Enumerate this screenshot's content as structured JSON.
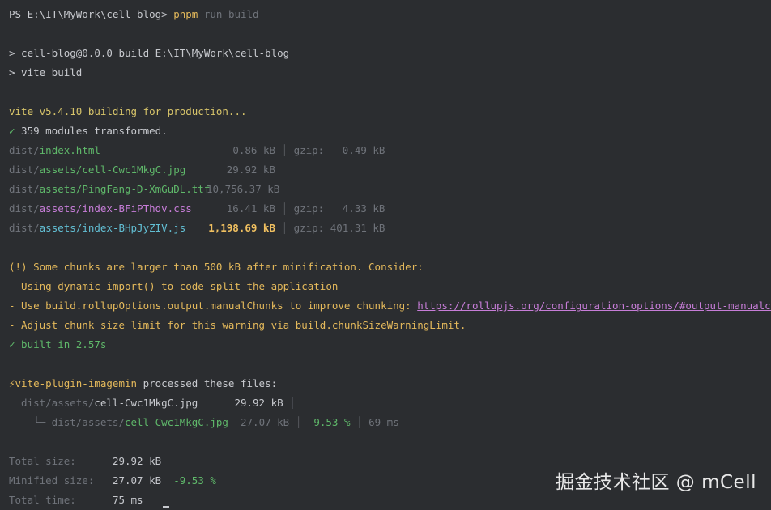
{
  "prompt": {
    "prefix": "PS E:\\IT\\MyWork\\cell-blog> ",
    "command": "pnpm",
    "args": " run build"
  },
  "script": {
    "line1": "> cell-blog@0.0.0 build E:\\IT\\MyWork\\cell-blog",
    "line2": "> vite build"
  },
  "vite": {
    "building": "vite v5.4.10 building for production...",
    "transformed": "✓ 359 modules transformed.",
    "outputs": [
      {
        "dir": "dist/",
        "name": "index.html",
        "color": "green",
        "size": "0.86 kB",
        "gzip": "gzip:   0.49 kB"
      },
      {
        "dir": "dist/",
        "name": "assets/cell-Cwc1MkgC.jpg",
        "color": "green",
        "size": "29.92 kB",
        "gzip": ""
      },
      {
        "dir": "dist/",
        "name": "assets/PingFang-D-XmGuDL.ttf",
        "color": "green",
        "size": "10,756.37 kB",
        "gzip": ""
      },
      {
        "dir": "dist/",
        "name": "assets/index-BFiPThdv.css",
        "color": "magenta",
        "size": "16.41 kB",
        "gzip": "gzip:   4.33 kB"
      },
      {
        "dir": "dist/",
        "name": "assets/index-BHpJyZIV.js",
        "color": "cyan",
        "size": "1,198.69 kB",
        "gzip": "gzip: 401.31 kB"
      }
    ]
  },
  "warning": {
    "line1": "(!) Some chunks are larger than 500 kB after minification. Consider:",
    "line2": "- Using dynamic import() to code-split the application",
    "line3_prefix": "- Use build.rollupOptions.output.manualChunks to improve chunking: ",
    "line3_link": "https://rollupjs.org/configuration-options/#output-manualchunks",
    "line4": "- Adjust chunk size limit for this warning via build.chunkSizeWarningLimit.",
    "built": "✓ built in 2.57s"
  },
  "imagemin": {
    "header_plugin": "⚡vite-plugin-imagemin",
    "header_rest": " processed these files:",
    "row1_dir": "  dist/assets/",
    "row1_file": "cell-Cwc1MkgC.jpg",
    "row1_size": "29.92 kB",
    "row2_prefix": "    └─ dist/assets/",
    "row2_file": "cell-Cwc1MkgC.jpg",
    "row2_size": "27.07 kB",
    "row2_ratio": "-9.53 %",
    "row2_time": "69 ms"
  },
  "summary": {
    "total_label": "Total size:",
    "total_value": "29.92 kB",
    "min_label": "Minified size:",
    "min_value": "27.07 kB",
    "min_ratio": "-9.53 %",
    "time_label": "Total time:",
    "time_value": "75 ms"
  },
  "watermark": "掘金技术社区 @ mCell"
}
